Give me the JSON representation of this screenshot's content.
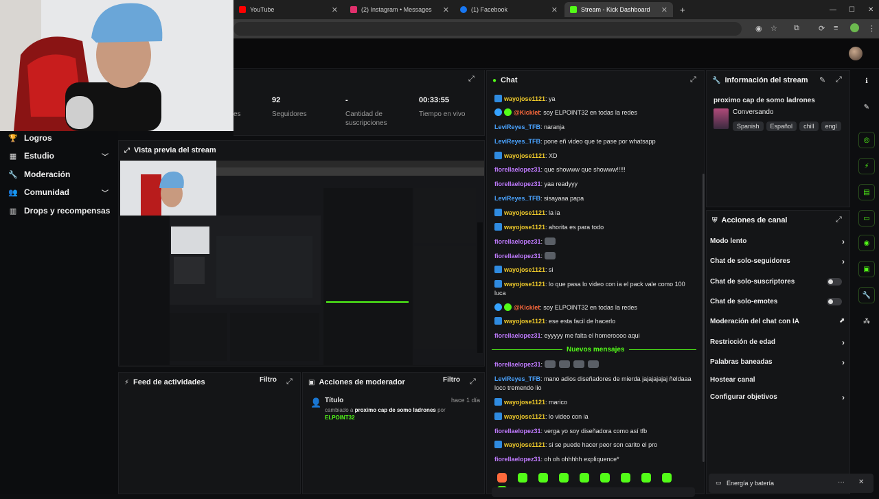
{
  "browser": {
    "tabs": [
      {
        "label": "YouTube",
        "color": "#ff0000"
      },
      {
        "label": "(2) Instagram • Messages",
        "color": "#e1306c"
      },
      {
        "label": "(1) Facebook",
        "color": "#1877f2"
      },
      {
        "label": "Stream - Kick Dashboard",
        "color": "#53fc18"
      }
    ],
    "new_tab": "+"
  },
  "sidebar": {
    "items": [
      {
        "label": "Logros",
        "icon": "trophy-icon"
      },
      {
        "label": "Estudio",
        "icon": "studio-icon"
      },
      {
        "label": "Moderación",
        "icon": "wrench-icon"
      },
      {
        "label": "Comunidad",
        "icon": "community-icon"
      },
      {
        "label": "Drops y recompensas",
        "icon": "drops-icon"
      }
    ]
  },
  "stats": {
    "partial_label": "es",
    "followers_value": "92",
    "followers_label": "Seguidores",
    "subs_value": "-",
    "subs_label": "Cantidad de suscripciones",
    "time_value": "00:33:55",
    "time_label": "Tiempo en vivo"
  },
  "preview": {
    "title": "Vista previa del stream"
  },
  "activity": {
    "title": "Feed de actividades",
    "filter": "Filtro"
  },
  "modactions": {
    "title": "Acciones de moderador",
    "filter": "Filtro",
    "entry_title": "Título",
    "entry_time": "hace 1 día",
    "entry_prefix": "cambiado a",
    "entry_value": "proximo cap de somo ladrones",
    "entry_by": "por",
    "entry_user": "ELPOINT32"
  },
  "chat": {
    "title": "Chat",
    "new_messages": "Nuevos mensajes",
    "messages": [
      {
        "user": "wayojose1121",
        "text": ": ya",
        "color": "yellow",
        "badge": "blue"
      },
      {
        "user": "@Kicklet",
        "text": ": soy ELPOINT32 en todas la redes",
        "color": "orange",
        "badge": "bot"
      },
      {
        "user": "LeviReyes_TFB",
        "text": ": naranja",
        "color": "blue",
        "badge": ""
      },
      {
        "user": "LeviReyes_TFB",
        "text": ": pone eñ video que te pase por whatsapp",
        "color": "blue",
        "badge": ""
      },
      {
        "user": "wayojose1121",
        "text": ": XD",
        "color": "yellow",
        "badge": "blue"
      },
      {
        "user": "fiorellaelopez31",
        "text": ": que showww que showww!!!!!",
        "color": "purple",
        "badge": ""
      },
      {
        "user": "fiorellaelopez31",
        "text": ": yaa readyyy",
        "color": "purple",
        "badge": ""
      },
      {
        "user": "LeviReyes_TFB",
        "text": ": sisayaaa papa",
        "color": "blue",
        "badge": ""
      },
      {
        "user": "wayojose1121",
        "text": ": la ia",
        "color": "yellow",
        "badge": "blue"
      },
      {
        "user": "wayojose1121",
        "text": ": ahorita es para todo",
        "color": "yellow",
        "badge": "blue"
      },
      {
        "user": "fiorellaelopez31",
        "text": ":",
        "color": "purple",
        "badge": ""
      },
      {
        "user": "fiorellaelopez31",
        "text": ":",
        "color": "purple",
        "badge": ""
      },
      {
        "user": "wayojose1121",
        "text": ": si",
        "color": "yellow",
        "badge": "blue"
      },
      {
        "user": "wayojose1121",
        "text": ": lo que pasa lo video con ia el pack vale como 100 luca",
        "color": "yellow",
        "badge": "blue"
      },
      {
        "user": "@Kicklet",
        "text": ": soy ELPOINT32 en todas la redes",
        "color": "orange",
        "badge": "bot"
      },
      {
        "user": "wayojose1121",
        "text": ": ese esta facil de hacerlo",
        "color": "yellow",
        "badge": "blue"
      },
      {
        "user": "fiorellaelopez31",
        "text": ": eyyyyy me falta el homeroooo aqui",
        "color": "purple",
        "badge": ""
      },
      {
        "user": "fiorellaelopez31",
        "text": ":",
        "color": "purple",
        "badge": ""
      },
      {
        "user": "LeviReyes_TFB",
        "text": ": mano adios diseñadores de mierda jajajajajaj ñeldaaa loco tremendo lio",
        "color": "blue",
        "badge": ""
      },
      {
        "user": "wayojose1121",
        "text": ": marico",
        "color": "yellow",
        "badge": "blue"
      },
      {
        "user": "wayojose1121",
        "text": ": lo video con ia",
        "color": "yellow",
        "badge": "blue"
      },
      {
        "user": "fiorellaelopez31",
        "text": ": verga yo soy diseñadora como así tfb",
        "color": "purple",
        "badge": ""
      },
      {
        "user": "wayojose1121",
        "text": ": si se puede hacer peor son carito el pro",
        "color": "yellow",
        "badge": "blue"
      },
      {
        "user": "fiorellaelopez31",
        "text": ": oh oh ohhhhh expliquence*",
        "color": "purple",
        "badge": ""
      }
    ]
  },
  "info": {
    "title": "Información del stream",
    "stream_title": "proximo cap de somo ladrones",
    "category": "Conversando",
    "tags": [
      "Spanish",
      "Español",
      "chill",
      "engl"
    ]
  },
  "actions": {
    "title": "Acciones de canal",
    "items": [
      {
        "label": "Modo lento",
        "kind": "chevron"
      },
      {
        "label": "Chat de solo-seguidores",
        "kind": "chevron"
      },
      {
        "label": "Chat de solo-suscriptores",
        "kind": "toggle"
      },
      {
        "label": "Chat de solo-emotes",
        "kind": "toggle"
      },
      {
        "label": "Moderación del chat con IA",
        "kind": "external"
      },
      {
        "label": "Restricción de edad",
        "kind": "chevron"
      },
      {
        "label": "Palabras baneadas",
        "kind": "chevron"
      },
      {
        "label": "Hostear canal",
        "kind": "none"
      },
      {
        "label": "Configurar objetivos",
        "kind": "chevron"
      }
    ]
  },
  "notification": {
    "label": "Energía y batería",
    "more": "···",
    "close": "✕"
  },
  "colors": {
    "accent": "#53fc18",
    "bg": "#0d0e10",
    "panel": "#141517"
  }
}
